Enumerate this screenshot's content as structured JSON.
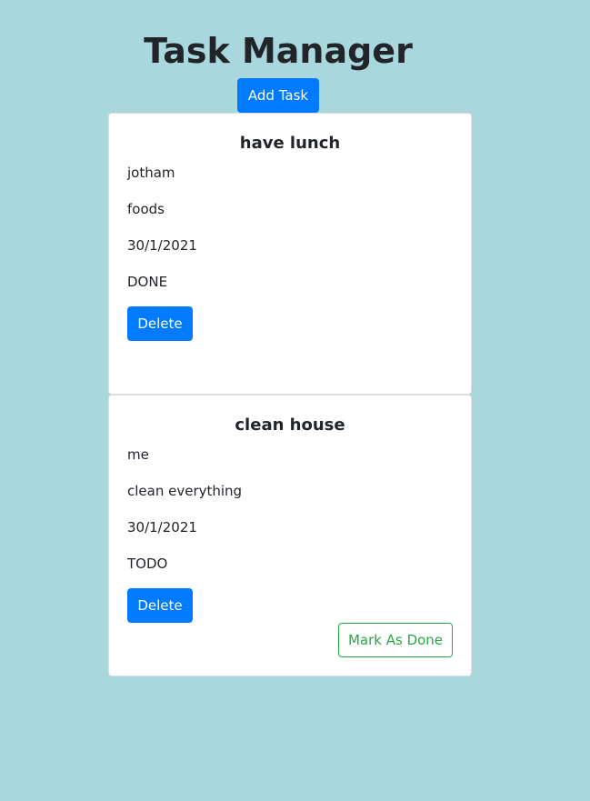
{
  "header": {
    "title": "Task Manager",
    "add_task_label": "Add Task"
  },
  "tasks": [
    {
      "title": "have lunch",
      "owner": "jotham",
      "description": "foods",
      "date": "30/1/2021",
      "status": "DONE",
      "delete_label": "Delete"
    },
    {
      "title": "clean house",
      "owner": "me",
      "description": "clean everything",
      "date": "30/1/2021",
      "status": "TODO",
      "delete_label": "Delete",
      "mark_done_label": "Mark As Done"
    }
  ],
  "colors": {
    "background": "#a8d8de",
    "primary": "#007bff",
    "success": "#28a745",
    "card": "#ffffff",
    "text": "#212529"
  }
}
